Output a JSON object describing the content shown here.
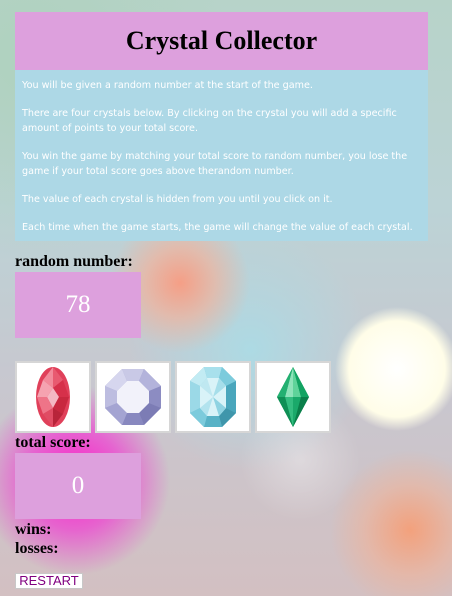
{
  "title": "Crystal Collector",
  "instructions": [
    "You will be given a random number at the start of the game.",
    "There are four crystals below. By clicking on the crystal you will add a specific amount of points to your total score.",
    "You win the game by matching your total score to random number, you lose the game if your total score goes above therandom number.",
    "The value of each crystal is hidden from you until you click on it.",
    "Each time when the game starts, the game will change the value of each crystal."
  ],
  "random_label": "random number:",
  "random_number": "78",
  "crystals": [
    {
      "icon": "red-oval-crystal-icon"
    },
    {
      "icon": "purple-octagon-crystal-icon"
    },
    {
      "icon": "blue-octagon-crystal-icon"
    },
    {
      "icon": "green-diamond-crystal-icon"
    }
  ],
  "total_label": "total score:",
  "total_score": "0",
  "wins_label": "wins:",
  "losses_label": "losses:",
  "restart_label": "RESTART"
}
